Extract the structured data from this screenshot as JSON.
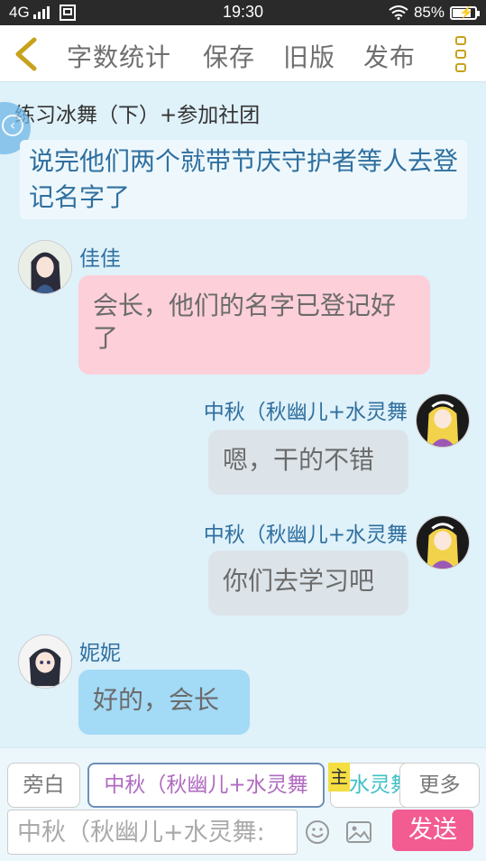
{
  "status_bar": {
    "network": "4G",
    "sim_icon": "sim-icon",
    "time": "19:30",
    "battery": "85%",
    "battery_level": 0.85
  },
  "top_bar": {
    "word_count": "字数统计",
    "save": "保存",
    "old_version": "旧版",
    "publish": "发布"
  },
  "narration": {
    "title": "练习冰舞（下）+参加社团",
    "text": "说完他们两个就带节庆守护者等人去登记名字了"
  },
  "messages": [
    {
      "sender": "佳佳",
      "text": "会长，他们的名字已登记好了",
      "side": "left",
      "color": "#fccfd9"
    },
    {
      "sender": "中秋（秋幽儿+水灵舞",
      "text": "嗯，干的不错",
      "side": "right",
      "color": "#dce4ea"
    },
    {
      "sender": "中秋（秋幽儿+水灵舞",
      "text": "你们去学习吧",
      "side": "right",
      "color": "#dce4ea"
    },
    {
      "sender": "妮妮",
      "text": "好的，会长",
      "side": "left",
      "color": "#a3daf6"
    }
  ],
  "bottom": {
    "narration_chip": "旁白",
    "character_chip": "中秋（秋幽儿+水灵舞",
    "main_tag": "主",
    "second_chip": "水灵舞",
    "more": "更多",
    "input_placeholder": "中秋（秋幽儿+水灵舞:",
    "send": "发送"
  },
  "colors": {
    "accent": "#f25c91",
    "back_arrow": "#c7a21b",
    "sender_name": "#2f6f9f"
  }
}
